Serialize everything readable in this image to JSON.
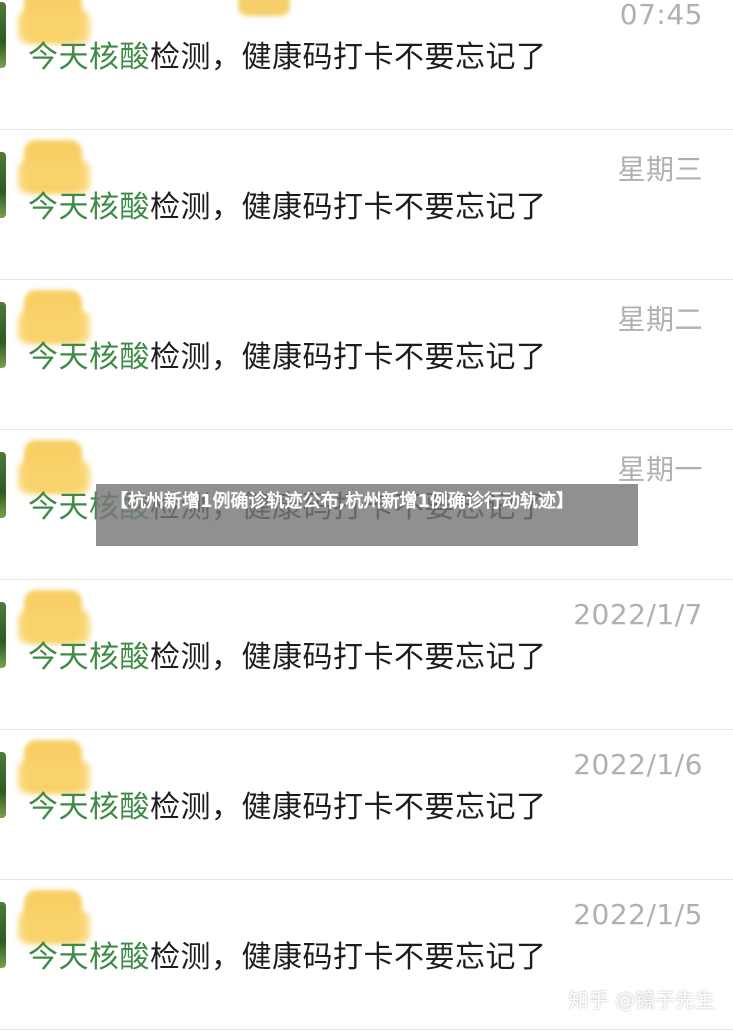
{
  "messages": [
    {
      "time": "07:45",
      "name": "",
      "message_highlight": "今天核酸",
      "message_rest": "检测，健康码打卡不要忘记了"
    },
    {
      "time": "星期三",
      "name": "",
      "message_highlight": "今天核酸",
      "message_rest": "检测，健康码打卡不要忘记了"
    },
    {
      "time": "星期二",
      "name": "",
      "message_highlight": "今天核酸",
      "message_rest": "检测，健康码打卡不要忘记了"
    },
    {
      "time": "星期一",
      "name": "",
      "message_highlight": "今天核酸",
      "message_rest": "检测，健康码打卡不要忘记了"
    },
    {
      "time": "2022/1/7",
      "name": "",
      "message_highlight": "今天核酸",
      "message_rest": "检测，健康码打卡不要忘记了"
    },
    {
      "time": "2022/1/6",
      "name": "",
      "message_highlight": "今天核酸",
      "message_rest": "检测，健康码打卡不要忘记了"
    },
    {
      "time": "2022/1/5",
      "name": "",
      "message_highlight": "今天核酸",
      "message_rest": "检测，健康码打卡不要忘记了"
    }
  ],
  "overlay": {
    "banner": "【杭州新增1例确诊轨迹公布,杭州新增1例确诊行动轨迹】",
    "watermark": "知乎 @镜子先生"
  },
  "colors": {
    "highlight": "#3f8a46",
    "time": "#b0b0b0",
    "text": "#1d1d1d",
    "divider": "#e6e6e6"
  }
}
